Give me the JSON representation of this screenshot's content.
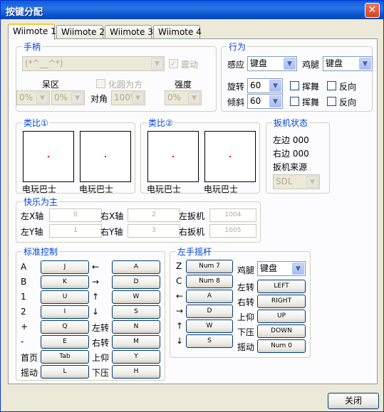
{
  "window": {
    "title": "按键分配",
    "close_glyph": "✕"
  },
  "tabs": [
    "Wiimote 1",
    "Wiimote 2",
    "Wiimote 3",
    "Wiimote 4"
  ],
  "handle": {
    "title": "手柄",
    "device_value": "(*^__^*)",
    "rumble_label": "震动",
    "deadzone_label": "呆区",
    "circle_to_square_label": "化圆为方",
    "diagonal_label": "对角",
    "strength_label": "强度",
    "dz_left": "0%",
    "dz_right": "0%",
    "diag_value": "100%",
    "strength_value": "0%"
  },
  "behavior": {
    "title": "行为",
    "sense_label": "感应",
    "sense_value": "键盘",
    "nunchuk_label": "鸡腿",
    "nunchuk_value": "键盘",
    "rotate_label": "旋转",
    "rotate_value": "60",
    "tilt_label": "倾斜",
    "tilt_value": "60",
    "swing_label": "挥舞",
    "reverse_label": "反向"
  },
  "analog1": {
    "title": "类比①",
    "left_label": "电玩巴士",
    "right_label": "电玩巴士"
  },
  "analog2": {
    "title": "类比②",
    "left_label": "电玩巴士",
    "right_label": "电玩巴士"
  },
  "trigger": {
    "title": "扳机状态",
    "left": "左边 000",
    "right": "右边 000",
    "source_label": "扳机来源",
    "source_value": "SDL"
  },
  "fun": {
    "title": "快乐为主",
    "lx_label": "左X轴",
    "lx_value": "0",
    "rx_label": "右X轴",
    "rx_value": "2",
    "lt_label": "左扳机",
    "lt_value": "1004",
    "ly_label": "左Y轴",
    "ly_value": "1",
    "ry_label": "右Y轴",
    "ry_value": "3",
    "rt_label": "右扳机",
    "rt_value": "1005"
  },
  "standard": {
    "title": "标准控制",
    "left_rows": [
      {
        "label": "A",
        "key": "J"
      },
      {
        "label": "B",
        "key": "K"
      },
      {
        "label": "1",
        "key": "U"
      },
      {
        "label": "2",
        "key": "I"
      },
      {
        "label": "+",
        "key": "Q"
      },
      {
        "label": "-",
        "key": "E"
      },
      {
        "label": "首页",
        "key": "Tab"
      },
      {
        "label": "摇动",
        "key": "L"
      }
    ],
    "right_rows": [
      {
        "label": "←",
        "key": "A"
      },
      {
        "label": "→",
        "key": "D"
      },
      {
        "label": "↑",
        "key": "W"
      },
      {
        "label": "↓",
        "key": "S"
      },
      {
        "label": "左转",
        "key": "N"
      },
      {
        "label": "右转",
        "key": "M"
      },
      {
        "label": "上仰",
        "key": "Y"
      },
      {
        "label": "下压",
        "key": "H"
      }
    ]
  },
  "leftstick": {
    "title": "左手摇杆",
    "left_rows": [
      {
        "label": "Z",
        "key": "Num 7"
      },
      {
        "label": "C",
        "key": "Num 8"
      },
      {
        "label": "←",
        "key": "A"
      },
      {
        "label": "→",
        "key": "D"
      },
      {
        "label": "↑",
        "key": "W"
      },
      {
        "label": "↓",
        "key": "S"
      }
    ],
    "nunchuk_label": "鸡腿",
    "nunchuk_value": "键盘",
    "right_rows": [
      {
        "label": "左转",
        "key": "LEFT"
      },
      {
        "label": "右转",
        "key": "RIGHT"
      },
      {
        "label": "上仰",
        "key": "UP"
      },
      {
        "label": "下压",
        "key": "DOWN"
      },
      {
        "label": "摇动",
        "key": "Num 0"
      }
    ]
  },
  "footer": {
    "close_label": "关闭"
  }
}
